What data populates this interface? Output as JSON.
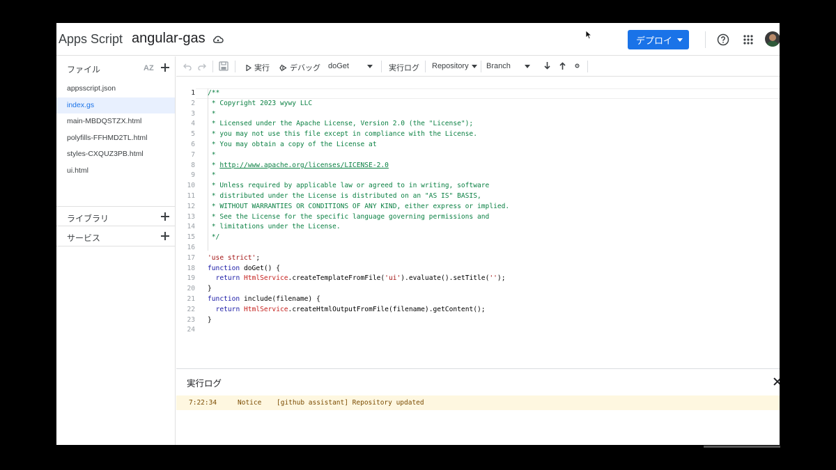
{
  "header": {
    "app_name": "Apps Script",
    "project_name": "angular-gas",
    "deploy_label": "デプロイ"
  },
  "sidebar": {
    "files_label": "ファイル",
    "sort_label": "AZ",
    "files": [
      {
        "name": "appsscript.json",
        "active": false
      },
      {
        "name": "index.gs",
        "active": true
      },
      {
        "name": "main-MBDQSTZX.html",
        "active": false
      },
      {
        "name": "polyfills-FFHMD2TL.html",
        "active": false
      },
      {
        "name": "styles-CXQUZ3PB.html",
        "active": false
      },
      {
        "name": "ui.html",
        "active": false
      }
    ],
    "libraries_label": "ライブラリ",
    "services_label": "サービス"
  },
  "toolbar": {
    "run_label": "実行",
    "debug_label": "デバッグ",
    "function_select": "doGet",
    "exec_log_label": "実行ログ",
    "repository_label": "Repository",
    "branch_label": "Branch"
  },
  "editor": {
    "current_line": 1,
    "lines": [
      "/**",
      " * Copyright 2023 wywy LLC",
      " *",
      " * Licensed under the Apache License, Version 2.0 (the \"License\");",
      " * you may not use this file except in compliance with the License.",
      " * You may obtain a copy of the License at",
      " *",
      " * http://www.apache.org/licenses/LICENSE-2.0",
      " *",
      " * Unless required by applicable law or agreed to in writing, software",
      " * distributed under the License is distributed on an \"AS IS\" BASIS,",
      " * WITHOUT WARRANTIES OR CONDITIONS OF ANY KIND, either express or implied.",
      " * See the License for the specific language governing permissions and",
      " * limitations under the License.",
      " */",
      "",
      "'use strict';",
      "function doGet() {",
      "  return HtmlService.createTemplateFromFile('ui').evaluate().setTitle('');",
      "}",
      "function include(filename) {",
      "  return HtmlService.createHtmlOutputFromFile(filename).getContent();",
      "}",
      ""
    ]
  },
  "log": {
    "title": "実行ログ",
    "entries": [
      {
        "time": "7:22:34",
        "level": "Notice",
        "message": "[github assistant] Repository updated"
      }
    ]
  },
  "colors": {
    "accent": "#1a73e8",
    "comment": "#0b8043",
    "log_notice_bg": "#fef7e0"
  }
}
